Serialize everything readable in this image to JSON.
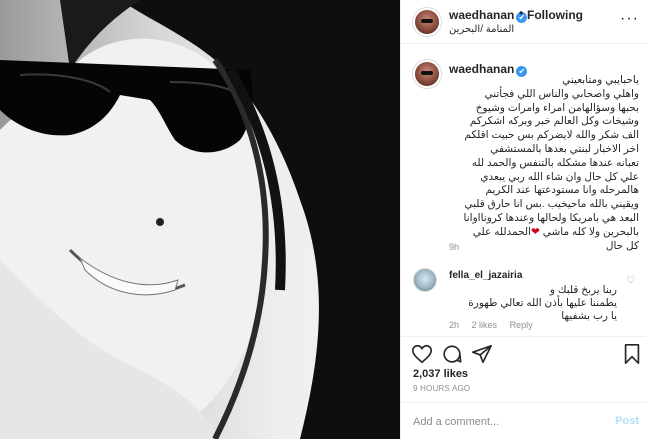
{
  "post": {
    "username": "waedhanan",
    "verified_mark": "✔",
    "separator": "•",
    "follow_status": "Following",
    "location": "المنامة /البحرين",
    "more": "···"
  },
  "caption": {
    "username": "waedhanan",
    "text": "ياحبايبي ومتابعيني\nواهلي واصحابي والناس اللي فجأتني\nبحبها وسؤالهامن امراء وامرات وشيوخ\nوشيخات وكل العالم خبر وبركه اشكركم\nالف شكر والله لايضركم بس حبيت اقلكم\nاخر الاخبار لبنتي بعدها بالمستشفي\nتعبانه عندها مشكله بالتنفس والحمد لله\nعلي كل حال وان شاء الله ربي يبعدي\nهالمرحله وانا مستودعتها عند الكريم\nويقيني بالله ماحيخيب .بس انا حارق قلبي\nالبعد هي بامريكا ولحالها وعندها كرونااوانا\nبالبحرين ولا كله ماشي",
    "text_end": "الحمدلله علي\nكل حال",
    "heart": "❤",
    "time": "9h"
  },
  "comment": {
    "username": "fella_el_jazairia",
    "text": "ربنا يربخ قلبك و\nيطمننا عليها بأذن الله تعالي طهورة\nيا رب بشفيها",
    "meta": [
      "2h",
      "2 likes",
      "Reply"
    ]
  },
  "engagement": {
    "likes": "2,037 likes",
    "time_ago": "9 HOURS AGO"
  },
  "compose": {
    "placeholder": "Add a comment...",
    "post_label": "Post"
  },
  "icons": [
    "heart-icon",
    "comment-icon",
    "share-icon",
    "bookmark-icon",
    "more-icon",
    "verified-icon"
  ],
  "colors": {
    "link_disabled": "#b2dffc",
    "verified": "#3897f0",
    "muted": "#8e8e8e",
    "text": "#262626"
  }
}
